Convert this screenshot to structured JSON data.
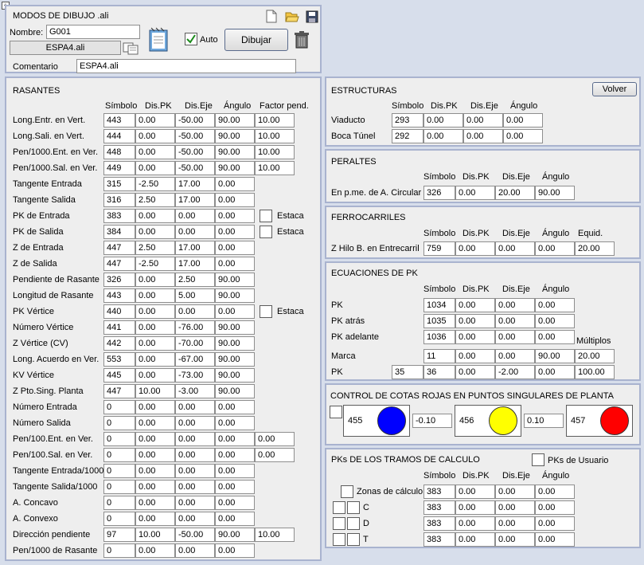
{
  "top": {
    "title": "MODOS DE DIBUJO .ali",
    "nombre_label": "Nombre:",
    "nombre_value": "G001",
    "file_value": "ESPA4.ali",
    "auto_label": "Auto",
    "dibujar_label": "Dibujar",
    "comentario_label": "Comentario",
    "comentario_value": "ESPA4.ali"
  },
  "rasantes": {
    "title": "RASANTES",
    "headers": [
      "Símbolo",
      "Dis.PK",
      "Dis.Eje",
      "Ángulo",
      "Factor pend."
    ],
    "estaca_label": "Estaca",
    "rows": [
      {
        "label": "Long.Entr. en Vert.",
        "v": [
          "443",
          "0.00",
          "-50.00",
          "90.00",
          "10.00"
        ]
      },
      {
        "label": "Long.Sali. en Vert.",
        "v": [
          "444",
          "0.00",
          "-50.00",
          "90.00",
          "10.00"
        ]
      },
      {
        "label": "Pen/1000.Ent. en Ver.",
        "v": [
          "448",
          "0.00",
          "-50.00",
          "90.00",
          "10.00"
        ]
      },
      {
        "label": "Pen/1000.Sal. en Ver.",
        "v": [
          "449",
          "0.00",
          "-50.00",
          "90.00",
          "10.00"
        ]
      },
      {
        "label": "Tangente Entrada",
        "v": [
          "315",
          "-2.50",
          "17.00",
          "0.00"
        ]
      },
      {
        "label": "Tangente Salida",
        "v": [
          "316",
          "2.50",
          "17.00",
          "0.00"
        ]
      },
      {
        "label": "PK de Entrada",
        "v": [
          "383",
          "0.00",
          "0.00",
          "0.00"
        ],
        "estaca": true
      },
      {
        "label": "PK de Salida",
        "v": [
          "384",
          "0.00",
          "0.00",
          "0.00"
        ],
        "estaca": true
      },
      {
        "label": "Z de Entrada",
        "v": [
          "447",
          "2.50",
          "17.00",
          "0.00"
        ]
      },
      {
        "label": "Z de Salida",
        "v": [
          "447",
          "-2.50",
          "17.00",
          "0.00"
        ]
      },
      {
        "label": "Pendiente de Rasante",
        "v": [
          "326",
          "0.00",
          "2.50",
          "90.00"
        ]
      },
      {
        "label": "Longitud de Rasante",
        "v": [
          "443",
          "0.00",
          "5.00",
          "90.00"
        ]
      },
      {
        "label": "PK Vértice",
        "v": [
          "440",
          "0.00",
          "0.00",
          "0.00"
        ],
        "estaca": true
      },
      {
        "label": "Número Vértice",
        "v": [
          "441",
          "0.00",
          "-76.00",
          "90.00"
        ]
      },
      {
        "label": "Z Vértice (CV)",
        "v": [
          "442",
          "0.00",
          "-70.00",
          "90.00"
        ]
      },
      {
        "label": "Long. Acuerdo en Ver.",
        "v": [
          "553",
          "0.00",
          "-67.00",
          "90.00"
        ]
      },
      {
        "label": "KV Vértice",
        "v": [
          "445",
          "0.00",
          "-73.00",
          "90.00"
        ]
      },
      {
        "label": "Z Pto.Sing. Planta",
        "v": [
          "447",
          "10.00",
          "-3.00",
          "90.00"
        ]
      },
      {
        "label": "Número Entrada",
        "v": [
          "0",
          "0.00",
          "0.00",
          "0.00"
        ]
      },
      {
        "label": "Número Salida",
        "v": [
          "0",
          "0.00",
          "0.00",
          "0.00"
        ]
      },
      {
        "label": "Pen/100.Ent. en Ver.",
        "v": [
          "0",
          "0.00",
          "0.00",
          "0.00",
          "0.00"
        ]
      },
      {
        "label": "Pen/100.Sal. en Ver.",
        "v": [
          "0",
          "0.00",
          "0.00",
          "0.00",
          "0.00"
        ]
      },
      {
        "label": "Tangente Entrada/1000",
        "v": [
          "0",
          "0.00",
          "0.00",
          "0.00"
        ]
      },
      {
        "label": "Tangente Salida/1000",
        "v": [
          "0",
          "0.00",
          "0.00",
          "0.00"
        ]
      },
      {
        "label": "A. Concavo",
        "v": [
          "0",
          "0.00",
          "0.00",
          "0.00"
        ]
      },
      {
        "label": "A. Convexo",
        "v": [
          "0",
          "0.00",
          "0.00",
          "0.00"
        ]
      },
      {
        "label": "Dirección pendiente",
        "v": [
          "97",
          "10.00",
          "-50.00",
          "90.00",
          "10.00"
        ]
      },
      {
        "label": "Pen/1000 de Rasante",
        "v": [
          "0",
          "0.00",
          "0.00",
          "0.00"
        ]
      }
    ]
  },
  "estructuras": {
    "title": "ESTRUCTURAS",
    "volver_label": "Volver",
    "headers": [
      "Símbolo",
      "Dis.PK",
      "Dis.Eje",
      "Ángulo"
    ],
    "rows": [
      {
        "label": "Viaducto",
        "v": [
          "293",
          "0.00",
          "0.00",
          "0.00"
        ]
      },
      {
        "label": "Boca Túnel",
        "v": [
          "292",
          "0.00",
          "0.00",
          "0.00"
        ]
      }
    ]
  },
  "peraltes": {
    "title": "PERALTES",
    "headers": [
      "Símbolo",
      "Dis.PK",
      "Dis.Eje",
      "Ángulo"
    ],
    "rows": [
      {
        "label": "En p.me. de A. Circular",
        "v": [
          "326",
          "0.00",
          "20.00",
          "90.00"
        ]
      }
    ]
  },
  "ferrocarriles": {
    "title": "FERROCARRILES",
    "headers": [
      "Símbolo",
      "Dis.PK",
      "Dis.Eje",
      "Ángulo",
      "Equid."
    ],
    "rows": [
      {
        "label": "Z Hilo B. en Entrecarril",
        "v": [
          "759",
          "0.00",
          "0.00",
          "0.00",
          "20.00"
        ]
      }
    ]
  },
  "ecuaciones": {
    "title": "ECUACIONES DE PK",
    "headers": [
      "Símbolo",
      "Dis.PK",
      "Dis.Eje",
      "Ángulo"
    ],
    "multiplos_label": "Múltiplos",
    "rows": [
      {
        "label": "PK",
        "v": [
          "1034",
          "0.00",
          "0.00",
          "0.00"
        ]
      },
      {
        "label": "PK atrás",
        "v": [
          "1035",
          "0.00",
          "0.00",
          "0.00"
        ]
      },
      {
        "label": "PK adelante",
        "v": [
          "1036",
          "0.00",
          "0.00",
          "0.00"
        ]
      }
    ],
    "marca": {
      "label": "Marca",
      "v": [
        "11",
        "0.00",
        "0.00",
        "90.00",
        "20.00"
      ]
    },
    "pk2": {
      "label": "PK",
      "pre": "35",
      "v": [
        "36",
        "0.00",
        "-2.00",
        "0.00",
        "100.00"
      ]
    }
  },
  "control": {
    "title": "CONTROL DE COTAS ROJAS EN PUNTOS SINGULARES DE PLANTA",
    "items": [
      {
        "code": "455",
        "color": "#0000ff"
      },
      {
        "code": "456",
        "color": "#ffff00"
      },
      {
        "code": "457",
        "color": "#ff0000"
      }
    ],
    "val1": "-0.10",
    "val2": "0.10"
  },
  "tramos": {
    "title": "PKs DE LOS TRAMOS DE CALCULO",
    "usuario_label": "PKs de Usuario",
    "headers": [
      "Símbolo",
      "Dis.PK",
      "Dis.Eje",
      "Ángulo"
    ],
    "rows": [
      {
        "label": "Zonas de cálculo",
        "v": [
          "383",
          "0.00",
          "0.00",
          "0.00"
        ]
      },
      {
        "label": "C",
        "v": [
          "383",
          "0.00",
          "0.00",
          "0.00"
        ]
      },
      {
        "label": "D",
        "v": [
          "383",
          "0.00",
          "0.00",
          "0.00"
        ]
      },
      {
        "label": "T",
        "v": [
          "383",
          "0.00",
          "0.00",
          "0.00"
        ]
      }
    ]
  }
}
